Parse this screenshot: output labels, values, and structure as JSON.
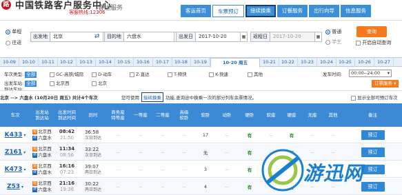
{
  "header": {
    "brand": "中国铁路客户服务中心",
    "hotline": "客服热线:12306",
    "sub_label": "客运服务",
    "nav": [
      "客运首页",
      "车票预订",
      "接续换乘",
      "订餐服务",
      "出行向导",
      "信息服务"
    ]
  },
  "search": {
    "one_way": "单程",
    "round_trip": "往返",
    "from_label": "出发地",
    "from_value": "北京",
    "to_label": "目的地",
    "to_value": "六盘水",
    "depart_label": "出发日",
    "depart_value": "2017-10-20",
    "return_label": "返程日",
    "return_value": "2017-10-20",
    "ordinary": "普通",
    "student": "学生",
    "query_btn": "查询",
    "auto_query": "开启自动查询"
  },
  "dates": [
    "10-09",
    "10-10",
    "10-11",
    "10-12",
    "10-13",
    "10-14",
    "10-15",
    "10-16",
    "10-17",
    "10-18",
    "10-19",
    "10-20 周五",
    "10-21",
    "10-22",
    "10-23",
    "10-24",
    "10-25",
    "10-26",
    "10-27"
  ],
  "filters": {
    "train_type_label": "车次类型:",
    "all": "全部",
    "types": [
      "GC-高铁/城际",
      "D-动车",
      "Z-直达",
      "T-特快",
      "K-快速",
      "其他"
    ],
    "depart_station_label": "出发车站:",
    "depart_station": "北京西",
    "arrive_station_label": "到达车站:",
    "arrive_station": "北京",
    "depart_time_label": "发车时间:",
    "depart_time_value": "00:00--24:00",
    "subscribe": "订票服务"
  },
  "result": {
    "prefix": "北京 --> 六盘水 (10月20日 周五) 共计4个车次",
    "middle": "您可使用",
    "link": "接续换乘",
    "suffix": "功能,查询途中换乘一次的部分列车余票情况。",
    "show_all": "显示全部可预订车次"
  },
  "table": {
    "headers": [
      "车次",
      "出发站\n到达站",
      "出发时间\n到达时间",
      "历时",
      "商务座\n特等座",
      "一等座",
      "二等座",
      "高级\n软卧",
      "软卧",
      "动卧",
      "硬卧",
      "软座",
      "硬座",
      "无座",
      "其他",
      "备注"
    ],
    "rows": [
      {
        "train": "K433",
        "from": "北京西",
        "to": "六盘水",
        "dep": "08:42",
        "arr": "21:50",
        "dur": "36:58",
        "day": "次日到达",
        "rw": "17",
        "yw": "有",
        "yz": "有",
        "book": "预订"
      },
      {
        "train": "Z161",
        "from": "北京西",
        "to": "六盘水",
        "dep": "11:34",
        "arr": "08:56",
        "dur": "33:22",
        "day": "次日到达",
        "rw": "无",
        "yw": "有",
        "yz": "有",
        "book": "预订"
      },
      {
        "train": "K473",
        "from": "北京西",
        "to": "六盘水",
        "dep": "16:16",
        "arr": "07:23",
        "dur": "39:07",
        "day": "两日到达",
        "rw": "3",
        "yw": "有",
        "yz": "有",
        "book": "预订"
      },
      {
        "train": "Z53",
        "from": "北京西",
        "to": "六盘水",
        "dep": "21:16",
        "arr": "19:38",
        "dur": "30:22",
        "day": "两日到达",
        "rw": "4",
        "yw": "有",
        "yz": "有",
        "book": "预订"
      }
    ]
  },
  "watermark": {
    "text": "游迅网"
  }
}
